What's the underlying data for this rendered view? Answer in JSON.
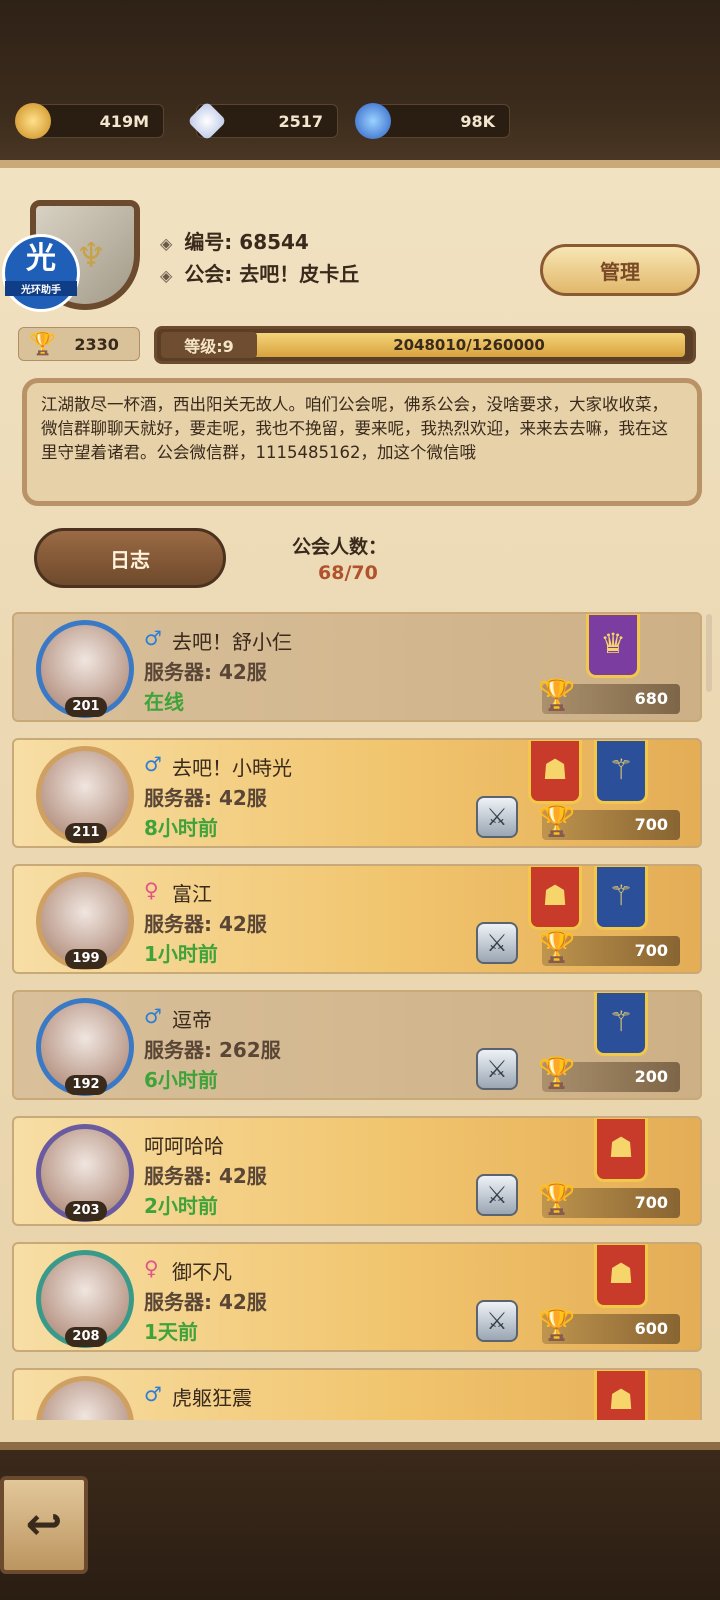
{
  "resources": {
    "gold": "419M",
    "gems": "2517",
    "essence": "98K"
  },
  "watermark": {
    "big": "光",
    "small": "光环助手"
  },
  "guild": {
    "id_label": "编号: 68544",
    "guild_label": "公会: 去吧！皮卡丘",
    "manage_label": "管理",
    "trophies": "2330",
    "level_label": "等级:9",
    "exp_text": "2048010/1260000",
    "description": "江湖散尽一杯酒，西出阳关无故人。咱们公会呢，佛系公会，没啥要求，大家收收菜，微信群聊聊天就好，要走呢，我也不挽留，要来呢，我热烈欢迎，来来去去嘛，我在这里守望着诸君。公会微信群，1115485162，加这个微信哦",
    "log_label": "日志",
    "member_count_label": "公会人数：",
    "member_count": "68/70"
  },
  "members": [
    {
      "name": "去吧！舒小仨",
      "gender": "♂",
      "server": "服务器: 42服",
      "status": "在线",
      "level": "201",
      "trophies": "680"
    },
    {
      "name": "去吧！小時光",
      "gender": "♂",
      "server": "服务器: 42服",
      "status": "8小时前",
      "level": "211",
      "trophies": "700"
    },
    {
      "name": "富江",
      "gender": "♀",
      "server": "服务器: 42服",
      "status": "1小时前",
      "level": "199",
      "trophies": "700"
    },
    {
      "name": "逗帝",
      "gender": "♂",
      "server": "服务器: 262服",
      "status": "6小时前",
      "level": "192",
      "trophies": "200"
    },
    {
      "name": "呵呵哈哈",
      "gender": "",
      "server": "服务器: 42服",
      "status": "2小时前",
      "level": "203",
      "trophies": "700"
    },
    {
      "name": "御不凡",
      "gender": "♀",
      "server": "服务器: 42服",
      "status": "1天前",
      "level": "208",
      "trophies": "600"
    },
    {
      "name": "虎躯狂震",
      "gender": "♂",
      "server": "",
      "status": "",
      "level": "",
      "trophies": ""
    }
  ],
  "icons": {
    "gold": "gold-coin-icon",
    "gem": "diamond-icon",
    "essence": "hero-essence-icon",
    "trophy": "trophy-icon",
    "swords": "crossed-swords-icon",
    "back": "back-arrow-icon"
  },
  "colors": {
    "online": "#3fa33a",
    "member_count": "#b0532c",
    "badge_purple": "#7b3ea0",
    "badge_red": "#c83a2a",
    "badge_blue": "#2c4f99"
  }
}
